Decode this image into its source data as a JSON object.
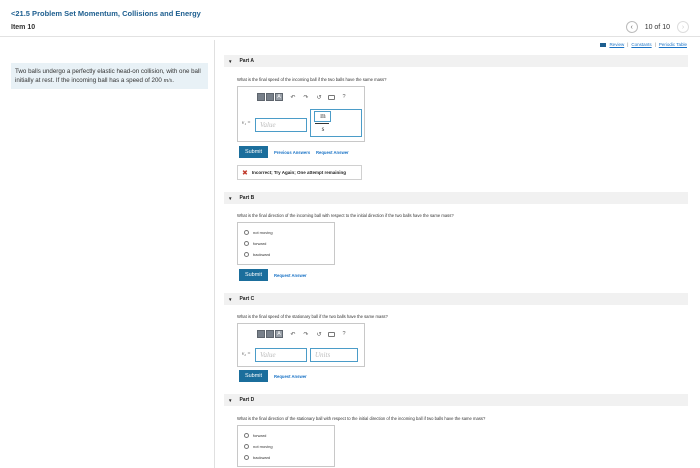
{
  "header": {
    "title": "<21.5 Problem Set Momentum, Collisions and Energy",
    "item": "Item 10",
    "pager": {
      "text": "10 of 10",
      "prev": "‹",
      "next": "›"
    }
  },
  "links": {
    "review": "Review",
    "sep1": "|",
    "constants": "Constants",
    "sep2": "|",
    "periodic": "Periodic Table"
  },
  "problem": {
    "text": "Two balls undergo a perfectly elastic head-on collision, with one ball initially at rest. If the incoming ball has a speed of 200",
    "unit": "m/s",
    "end": "."
  },
  "partA": {
    "title": "Part A",
    "question": "What is the final speed of the incoming ball if the two balls have the same mass?",
    "var_label": "v₁ =",
    "value_placeholder": "Value",
    "unit_num": "m",
    "unit_den": "s",
    "submit": "Submit",
    "prev_answers": "Previous Answers",
    "request": "Request Answer",
    "feedback": "Incorrect; Try Again; One attempt remaining"
  },
  "partB": {
    "title": "Part B",
    "question": "What is the final direction of the incoming ball with respect to the initial direction if the two balls have the same mass?",
    "options": [
      "not moving",
      "forward",
      "backward"
    ],
    "submit": "Submit",
    "request": "Request Answer"
  },
  "partC": {
    "title": "Part C",
    "question": "What is the final speed of the stationary ball if the two balls have the same mass?",
    "var_label": "v₂ =",
    "value_placeholder": "Value",
    "units_placeholder": "Units",
    "submit": "Submit",
    "request": "Request Answer"
  },
  "partD": {
    "title": "Part D",
    "question": "What is the final direction of the stationary ball with respect to the initial direction of the incoming ball if two balls have the same mass?",
    "options": [
      "forward",
      "not moving",
      "backward"
    ]
  },
  "toolbar": {
    "alpha": "A",
    "undo": "↶",
    "redo": "↷",
    "reset": "↺",
    "help": "?"
  },
  "icons": {
    "expanded": "▼",
    "incorrect": "✖"
  },
  "colors": {
    "title": "#1d5e8f",
    "submit": "#1b6e9c",
    "link": "#1a73c6",
    "input_border": "#4b9cc8",
    "panel": "#e8f1f6"
  }
}
